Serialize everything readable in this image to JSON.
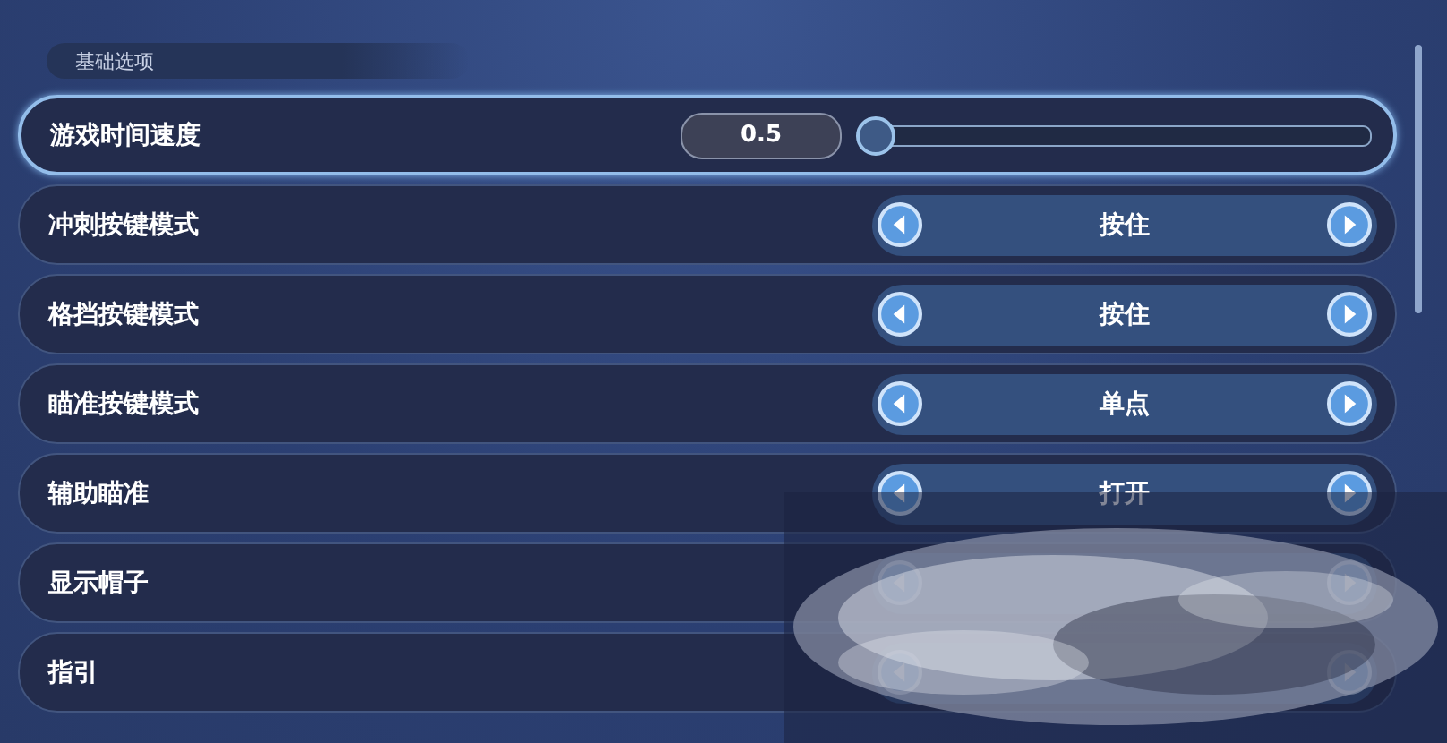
{
  "section": {
    "title": "基础选项"
  },
  "settings": [
    {
      "kind": "slider",
      "label": "游戏时间速度",
      "value": "0.5",
      "level": 0,
      "selected": true
    },
    {
      "kind": "selector",
      "label": "冲刺按键模式",
      "value": "按住",
      "selected": false
    },
    {
      "kind": "selector",
      "label": "格挡按键模式",
      "value": "按住",
      "selected": false
    },
    {
      "kind": "selector",
      "label": "瞄准按键模式",
      "value": "单点",
      "selected": false
    },
    {
      "kind": "selector",
      "label": "辅助瞄准",
      "value": "打开",
      "selected": false
    },
    {
      "kind": "selector",
      "label": "显示帽子",
      "selected": false
    },
    {
      "kind": "selector",
      "label": "指引",
      "selected": false
    }
  ]
}
